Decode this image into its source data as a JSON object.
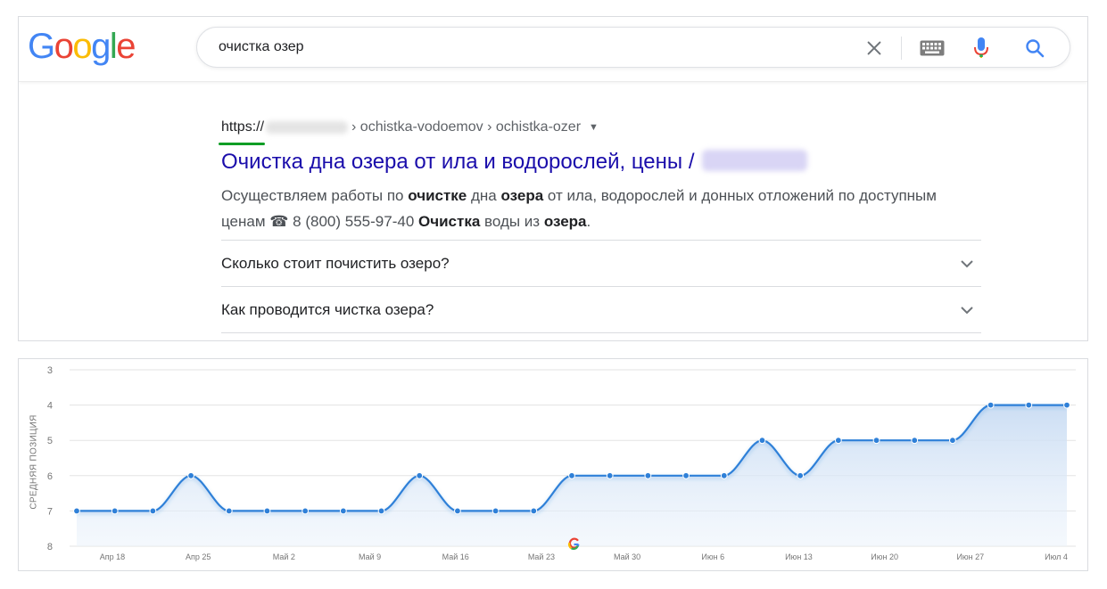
{
  "logo": {
    "letters": [
      "G",
      "o",
      "o",
      "g",
      "l",
      "e"
    ],
    "colors": [
      "#4285F4",
      "#EA4335",
      "#FBBC05",
      "#4285F4",
      "#34A853",
      "#EA4335"
    ]
  },
  "search": {
    "query": "очистка озер",
    "icons": [
      "close-icon",
      "keyboard-icon",
      "mic-icon",
      "search-icon"
    ]
  },
  "result": {
    "url_scheme": "https://",
    "breadcrumb_path": "› ochistka-vodoemov › ochistka-ozer",
    "title": "Очистка дна озера от ила и водорослей, цены /",
    "snippet": [
      {
        "t": "Осуществляем работы по ",
        "b": false
      },
      {
        "t": "очистке",
        "b": true
      },
      {
        "t": " дна ",
        "b": false
      },
      {
        "t": "озера",
        "b": true
      },
      {
        "t": " от ила, водорослей и донных отложений по доступным ценам ",
        "b": false
      },
      {
        "t": "☎",
        "b": false
      },
      {
        "t": " 8 (800) 555-97-40 ",
        "b": false
      },
      {
        "t": "Очистка",
        "b": true
      },
      {
        "t": " воды из ",
        "b": false
      },
      {
        "t": "озера",
        "b": true
      },
      {
        "t": ".",
        "b": false
      }
    ],
    "faq": [
      "Сколько стоит почистить озеро?",
      "Как проводится чистка озера?"
    ]
  },
  "colors": {
    "link": "#1a0dab",
    "https_underline": "#0f9d25",
    "series_line": "#2f80d8"
  },
  "chart_data": {
    "type": "line",
    "title": "",
    "xlabel": "",
    "ylabel": "СРЕДНЯЯ ПОЗИЦИЯ",
    "y_inverted": true,
    "ylim": [
      3,
      8
    ],
    "yticks": [
      3,
      4,
      5,
      6,
      7,
      8
    ],
    "grid": true,
    "smooth": true,
    "area_fill": true,
    "x_tick_labels": [
      "Апр 18",
      "Апр 25",
      "Май 2",
      "Май 9",
      "Май 16",
      "Май 23",
      "Май 30",
      "Июн 6",
      "Июн 13",
      "Июн 20",
      "Июн 27",
      "Июл 4"
    ],
    "values": [
      7,
      7,
      7,
      6,
      7,
      7,
      7,
      7,
      7,
      6,
      7,
      7,
      7,
      6,
      6,
      6,
      6,
      6,
      5,
      6,
      5,
      5,
      5,
      5,
      4,
      4,
      4
    ],
    "annotation_icon": "google-g-icon"
  }
}
